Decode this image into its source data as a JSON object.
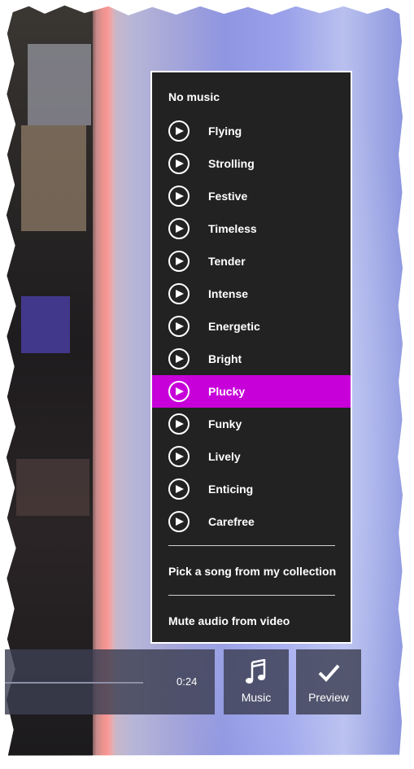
{
  "menu": {
    "no_music": "No music",
    "items": [
      {
        "label": "Flying"
      },
      {
        "label": "Strolling"
      },
      {
        "label": "Festive"
      },
      {
        "label": "Timeless"
      },
      {
        "label": "Tender"
      },
      {
        "label": "Intense"
      },
      {
        "label": "Energetic"
      },
      {
        "label": "Bright"
      },
      {
        "label": "Plucky",
        "selected": true
      },
      {
        "label": "Funky"
      },
      {
        "label": "Lively"
      },
      {
        "label": "Enticing"
      },
      {
        "label": "Carefree"
      }
    ],
    "pick_song": "Pick a song from my collection",
    "mute_audio": "Mute audio from video",
    "accent_color": "#c700d9"
  },
  "playback": {
    "time": "0:24"
  },
  "toolbar": {
    "music_label": "Music",
    "preview_label": "Preview",
    "music_icon": "music-note-icon",
    "preview_icon": "checkmark-icon"
  }
}
